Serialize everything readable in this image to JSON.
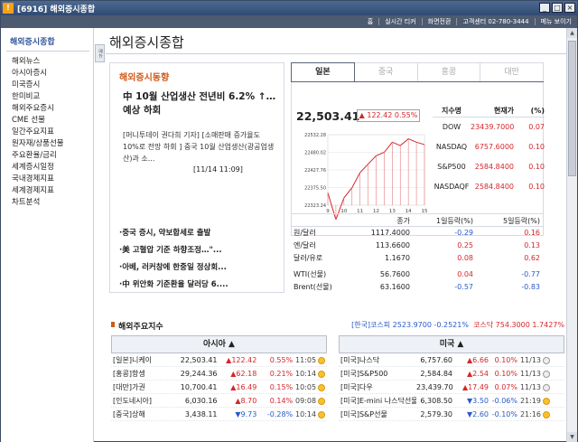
{
  "window": {
    "code": "[6916]",
    "title": "해외증시종합",
    "btn_min": "_",
    "btn_max": "□",
    "btn_close": "×"
  },
  "toolbar": [
    "홈",
    "실시간 티커",
    "화면전환",
    "고객센터 02-780-3444",
    "메뉴 보이기"
  ],
  "sidebar": {
    "title": "해외증시종합",
    "items": [
      "해외뉴스",
      "아시아증시",
      "미국증시",
      "한미비교",
      "해외주요증시",
      "CME 선물",
      "일간주요지표",
      "원자재/상품선물",
      "주요환율/금리",
      "세계증시일정",
      "국내경제지표",
      "세계경제지표",
      "차트분석"
    ],
    "collapse": "메뉴"
  },
  "page_title": "해외증시종합",
  "news": {
    "title": "해외증시동향",
    "headline": "中 10월 산업생산 전년비 6.2% ↑…예상 하회",
    "summary": "[머니투데이 권다희 기자] [소매판매 증가율도 10%로 전망 하회 ] 중국 10월 산업생산(광공업생산)과 소...",
    "date": "[11/14 11:09]",
    "list": [
      "중국 증시, 약보합세로 출발",
      "美 고혈압 기준 하향조정…\"...",
      "아베, 러커창에 한중일 정상회...",
      "中 위안화 기준환율 달러당 6...."
    ]
  },
  "tabs": [
    "일본",
    "중국",
    "홍콩",
    "대만"
  ],
  "index": {
    "value": "22,503.41",
    "change": "▲ 122.42",
    "pct": "0.55%"
  },
  "chart_data": {
    "type": "line",
    "x": [
      9,
      9.5,
      10,
      10.5,
      11,
      11.5,
      12,
      12.5,
      13,
      13.5,
      14,
      14.5,
      15
    ],
    "values": [
      22360,
      22280,
      22345,
      22375,
      22420,
      22445,
      22470,
      22480,
      22510,
      22500,
      22520,
      22510,
      22503
    ],
    "yticks": [
      "22532.28",
      "22480.02",
      "22427.76",
      "22375.50",
      "22323.24"
    ],
    "xticks": [
      "9",
      "10",
      "11",
      "12",
      "13",
      "14",
      "15"
    ],
    "ylim": [
      22323.24,
      22532.28
    ]
  },
  "us_table": {
    "headers": [
      "지수명",
      "현재가",
      "(%)"
    ],
    "rows": [
      [
        "DOW",
        "23439.7000",
        "0.07"
      ],
      [
        "NASDAQ",
        "6757.6000",
        "0.10"
      ],
      [
        "S&P500",
        "2584.8400",
        "0.10"
      ],
      [
        "NASDAQF",
        "2584.8400",
        "0.10"
      ]
    ]
  },
  "fx": {
    "headers": [
      "",
      "종가",
      "1일등락(%)",
      "5일등락(%)"
    ],
    "rows": [
      [
        "원/달러",
        "1117.4000",
        "-0.29",
        "0.16"
      ],
      [
        "엔/달러",
        "113.6600",
        "0.25",
        "0.13"
      ],
      [
        "달러/유로",
        "1.1670",
        "0.08",
        "0.62"
      ]
    ],
    "rows2": [
      [
        "WTI(선물)",
        "56.7600",
        "0.04",
        "-0.77"
      ],
      [
        "Brent(선물)",
        "63.1600",
        "-0.57",
        "-0.83"
      ]
    ]
  },
  "majors": {
    "title": "해외주요지수",
    "kr": "[한국]코스피 2523.9700 -0.2521%",
    "kosdaq": "코스닥 754.3000 1.7427%"
  },
  "asia": {
    "title": "아시아 ▲",
    "rows": [
      [
        "[일본]니케이",
        "22,503.41",
        "▲122.42",
        "0.55%",
        "11:05",
        "sun"
      ],
      [
        "[홍콩]항셍",
        "29,244.36",
        "▲62.18",
        "0.21%",
        "10:14",
        "sun"
      ],
      [
        "[대만]가권",
        "10,700.41",
        "▲16.49",
        "0.15%",
        "10:05",
        "sun"
      ],
      [
        "[인도네시아]",
        "6,030.16",
        "▲8.70",
        "0.14%",
        "09:08",
        "sun"
      ],
      [
        "[중국]상해",
        "3,438.11",
        "▼9.73",
        "-0.28%",
        "10:14",
        "sun"
      ]
    ]
  },
  "us": {
    "title": "미국 ▲",
    "rows": [
      [
        "[미국]나스닥",
        "6,757.60",
        "▲6.66",
        "0.10%",
        "11/13",
        "moon"
      ],
      [
        "[미국]S&P500",
        "2,584.84",
        "▲2.54",
        "0.10%",
        "11/13",
        "moon"
      ],
      [
        "[미국]다우",
        "23,439.70",
        "▲17.49",
        "0.07%",
        "11/13",
        "moon"
      ],
      [
        "[미국]E-mini 나스닥선물",
        "6,308.50",
        "▼3.50",
        "-0.06%",
        "21:19",
        "sun"
      ],
      [
        "[미국]S&P선물",
        "2,579.30",
        "▼2.60",
        "-0.10%",
        "21:16",
        "sun"
      ]
    ]
  }
}
